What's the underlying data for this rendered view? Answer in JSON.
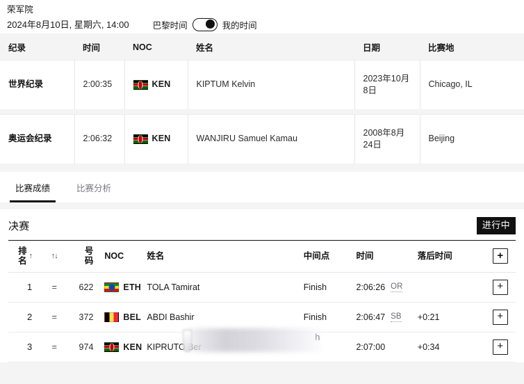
{
  "header": {
    "venue": "荣军院",
    "session_datetime": "2024年8月10日, 星期六, 14:00",
    "timezone_left_label": "巴黎时间",
    "timezone_right_label": "我的时间",
    "toggle_state": "我的时间"
  },
  "records_table": {
    "columns": [
      "纪录",
      "时间",
      "NOC",
      "姓名",
      "日期",
      "比赛地"
    ],
    "rows": [
      {
        "record": "世界纪录",
        "time": "2:00:35",
        "noc_code": "KEN",
        "noc_flag": "flag-ken",
        "name": "KIPTUM Kelvin",
        "date": "2023年10月8日",
        "place": "Chicago, IL"
      },
      {
        "record": "奥运会纪录",
        "time": "2:06:32",
        "noc_code": "KEN",
        "noc_flag": "flag-ken",
        "name": "WANJIRU Samuel Kamau",
        "date": "2008年8月24日",
        "place": "Beijing"
      }
    ]
  },
  "tabs": [
    {
      "label": "比赛成绩",
      "active": true
    },
    {
      "label": "比赛分析",
      "active": false
    }
  ],
  "results": {
    "phase_title": "决赛",
    "status_badge": "进行中",
    "status_badge_bg": "#111111",
    "status_badge_color": "#ffffff",
    "columns": {
      "rank": "排名",
      "rank_sort_icon": "↑",
      "change_sort_icon": "↑↓",
      "bib": "号码",
      "noc": "NOC",
      "name": "姓名",
      "midpoint": "中间点",
      "time": "时间",
      "behind": "落后时间",
      "add": "+"
    },
    "rows": [
      {
        "rank": "1",
        "change": "=",
        "bib": "622",
        "noc_code": "ETH",
        "noc_flag": "flag-eth",
        "name": "TOLA Tamirat",
        "midpoint": "Finish",
        "time": "2:06:26",
        "record_tag": "OR",
        "behind": "",
        "add": "+",
        "obscured": false
      },
      {
        "rank": "2",
        "change": "=",
        "bib": "372",
        "noc_code": "BEL",
        "noc_flag": "flag-bel",
        "name": "ABDI Bashir",
        "midpoint": "Finish",
        "time": "2:06:47",
        "record_tag": "SB",
        "behind": "+0:21",
        "add": "+",
        "obscured": false
      },
      {
        "rank": "3",
        "change": "=",
        "bib": "974",
        "noc_code": "KEN",
        "noc_flag": "flag-ken",
        "name": "KIPRUTO Ber",
        "name_tail": "h",
        "midpoint": "",
        "time": "2:07:00",
        "record_tag": "",
        "behind": "+0:34",
        "add": "+",
        "obscured": true
      }
    ]
  }
}
